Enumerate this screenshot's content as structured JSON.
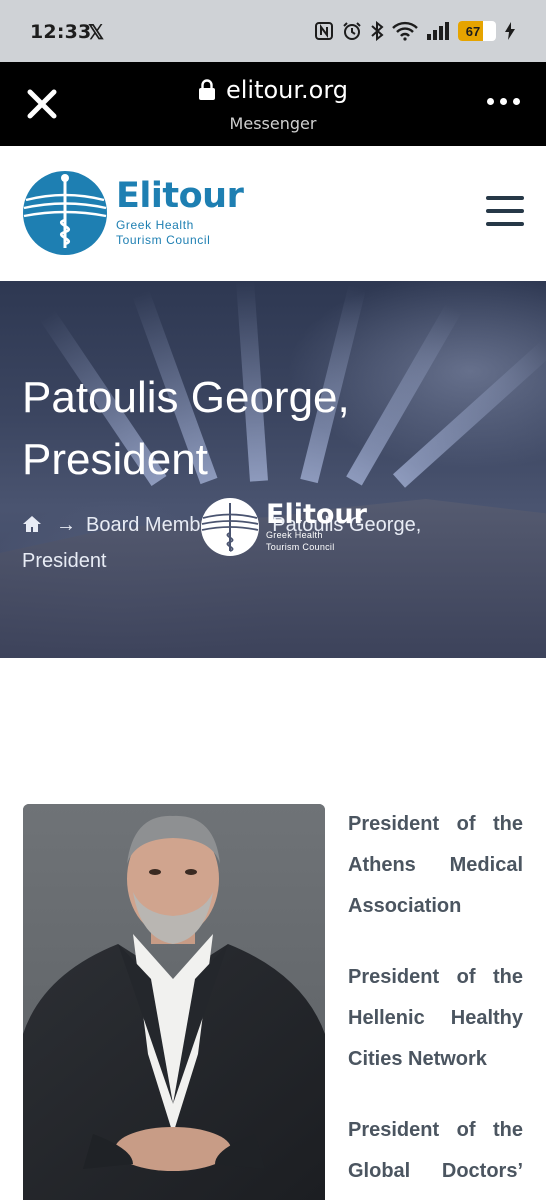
{
  "status_bar": {
    "time": "12:33",
    "x_label": "𝕏",
    "battery_level": "67",
    "icons": [
      "nfc-icon",
      "alarm-icon",
      "bluetooth-icon",
      "wifi-icon",
      "signal-icon",
      "battery-icon",
      "charging-icon"
    ]
  },
  "browser": {
    "url": "elitour.org",
    "subtitle": "Messenger",
    "icons": [
      "close-icon",
      "lock-icon",
      "more-icon"
    ]
  },
  "site": {
    "logo_name": "Elitour",
    "logo_sub_line1": "Greek Health",
    "logo_sub_line2": "Tourism Council",
    "brand_color": "#1e7fb2"
  },
  "hero": {
    "title_line1": "Patoulis George,",
    "title_line2": "President",
    "breadcrumb": {
      "home_icon": "home-icon",
      "separator": "→",
      "parent": "Board Members",
      "current_line1": "Patoulis George,",
      "current_line2": "President"
    },
    "watermark": {
      "name": "Elitour",
      "sub_line1": "Greek Health",
      "sub_line2": "Tourism Council"
    }
  },
  "content": {
    "roles": [
      {
        "words": [
          "President",
          "of",
          "the"
        ],
        "last_line": [
          "Athens",
          "Medical"
        ],
        "tail": "Association"
      },
      {
        "words": [
          "President",
          "of",
          "the"
        ],
        "last_line": [
          "Hellenic",
          "Healthy"
        ],
        "tail": "Cities Network"
      },
      {
        "words": [
          "President",
          "of",
          "the"
        ],
        "last_line": [
          "Global",
          "Doctors’"
        ],
        "tail": ""
      }
    ]
  }
}
